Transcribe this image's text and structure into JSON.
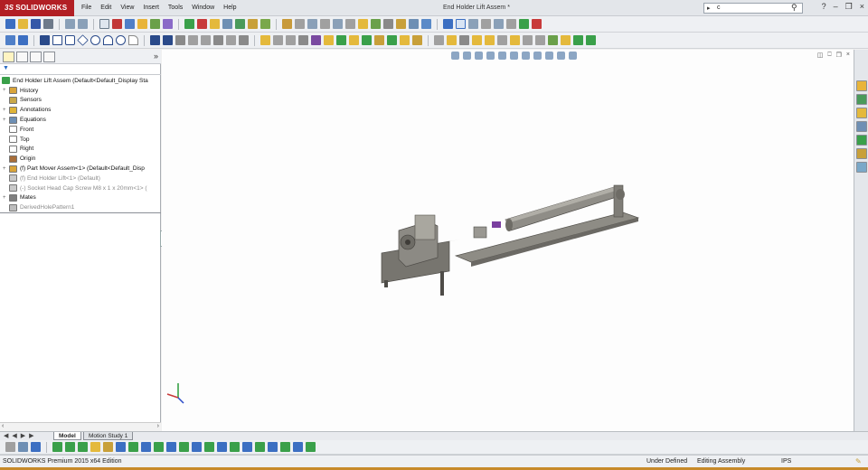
{
  "app": {
    "name": "SOLIDWORKS",
    "document_title": "End Holder Lift Assem *"
  },
  "menu": [
    "File",
    "Edit",
    "View",
    "Insert",
    "Tools",
    "Window",
    "Help"
  ],
  "search": {
    "value": "c"
  },
  "feature_tree": {
    "root": "End Holder Lift Assem  (Default<Default_Display Sta",
    "items": [
      {
        "label": "History",
        "icon": "history-icon",
        "color": "#d9a43a",
        "expand": "+"
      },
      {
        "label": "Sensors",
        "icon": "sensors-icon",
        "color": "#c9a84a",
        "expand": ""
      },
      {
        "label": "Annotations",
        "icon": "annotations-icon",
        "color": "#e0b437",
        "expand": "+"
      },
      {
        "label": "Equations",
        "icon": "equations-icon",
        "color": "#6e8fb4",
        "expand": "+"
      },
      {
        "label": "Front",
        "icon": "plane-icon",
        "color": "#ffffff",
        "expand": ""
      },
      {
        "label": "Top",
        "icon": "plane-icon",
        "color": "#ffffff",
        "expand": ""
      },
      {
        "label": "Right",
        "icon": "plane-icon",
        "color": "#ffffff",
        "expand": ""
      },
      {
        "label": "Origin",
        "icon": "origin-icon",
        "color": "#a86e3a",
        "expand": ""
      },
      {
        "label": "(f) Part Mover Assem<1> (Default<Default_Disp",
        "icon": "assembly-icon",
        "color": "#d9a43a",
        "expand": "+"
      },
      {
        "label": "(f) End Holder Lift<1> (Default)",
        "icon": "part-icon",
        "color": "#c9c9c9",
        "expand": "",
        "grey": true
      },
      {
        "label": "(-) Socket Head Cap Screw M8 x 1 x 20mm<1> (",
        "icon": "part-icon",
        "color": "#c9c9c9",
        "expand": "",
        "grey": true
      },
      {
        "label": "Mates",
        "icon": "mates-icon",
        "color": "#7f7f7f",
        "expand": "+"
      },
      {
        "label": "DerivedHolePattern1",
        "icon": "pattern-icon",
        "color": "#bdbdbd",
        "expand": "",
        "grey": true
      }
    ]
  },
  "tabs": {
    "model": "Model",
    "motion": "Motion Study 1"
  },
  "status": {
    "edition": "SOLIDWORKS Premium 2015 x64 Edition",
    "definition": "Under Defined",
    "mode": "Editing Assembly",
    "units": "IPS"
  },
  "colors": {
    "brand": "#b21f24",
    "model_body": "#8a8880",
    "cylinder_accent": "#7a3fa0"
  }
}
